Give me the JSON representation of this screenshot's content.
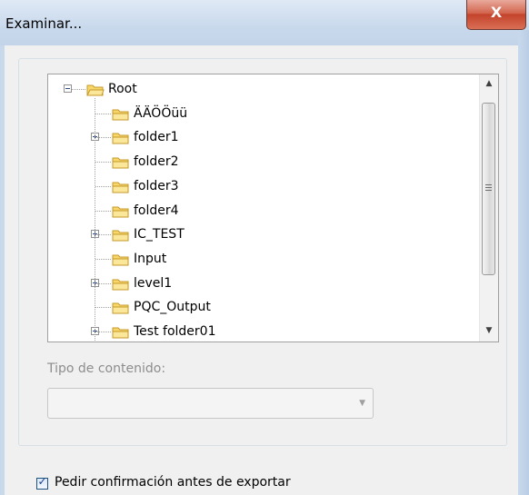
{
  "window": {
    "title": "Examinar...",
    "close_glyph": "X"
  },
  "tree": {
    "root": {
      "label": "Root",
      "expanded": true,
      "icon": "folder-open-icon"
    },
    "children": [
      {
        "label": "ÄÄÖÖüü",
        "expandable": false
      },
      {
        "label": "folder1",
        "expandable": true
      },
      {
        "label": "folder2",
        "expandable": false
      },
      {
        "label": "folder3",
        "expandable": false
      },
      {
        "label": "folder4",
        "expandable": false
      },
      {
        "label": "IC_TEST",
        "expandable": true
      },
      {
        "label": "Input",
        "expandable": false
      },
      {
        "label": "level1",
        "expandable": true
      },
      {
        "label": "PQC_Output",
        "expandable": false
      },
      {
        "label": "Test folder01",
        "expandable": true
      }
    ]
  },
  "content_type": {
    "label": "Tipo de contenido:",
    "value": "",
    "enabled": false
  },
  "confirm_export": {
    "label": "Pedir confirmación antes de exportar",
    "checked": true
  },
  "colors": {
    "folder_fill": "#f7d66a",
    "folder_stroke": "#c49a2a",
    "close_red": "#c4432b"
  }
}
